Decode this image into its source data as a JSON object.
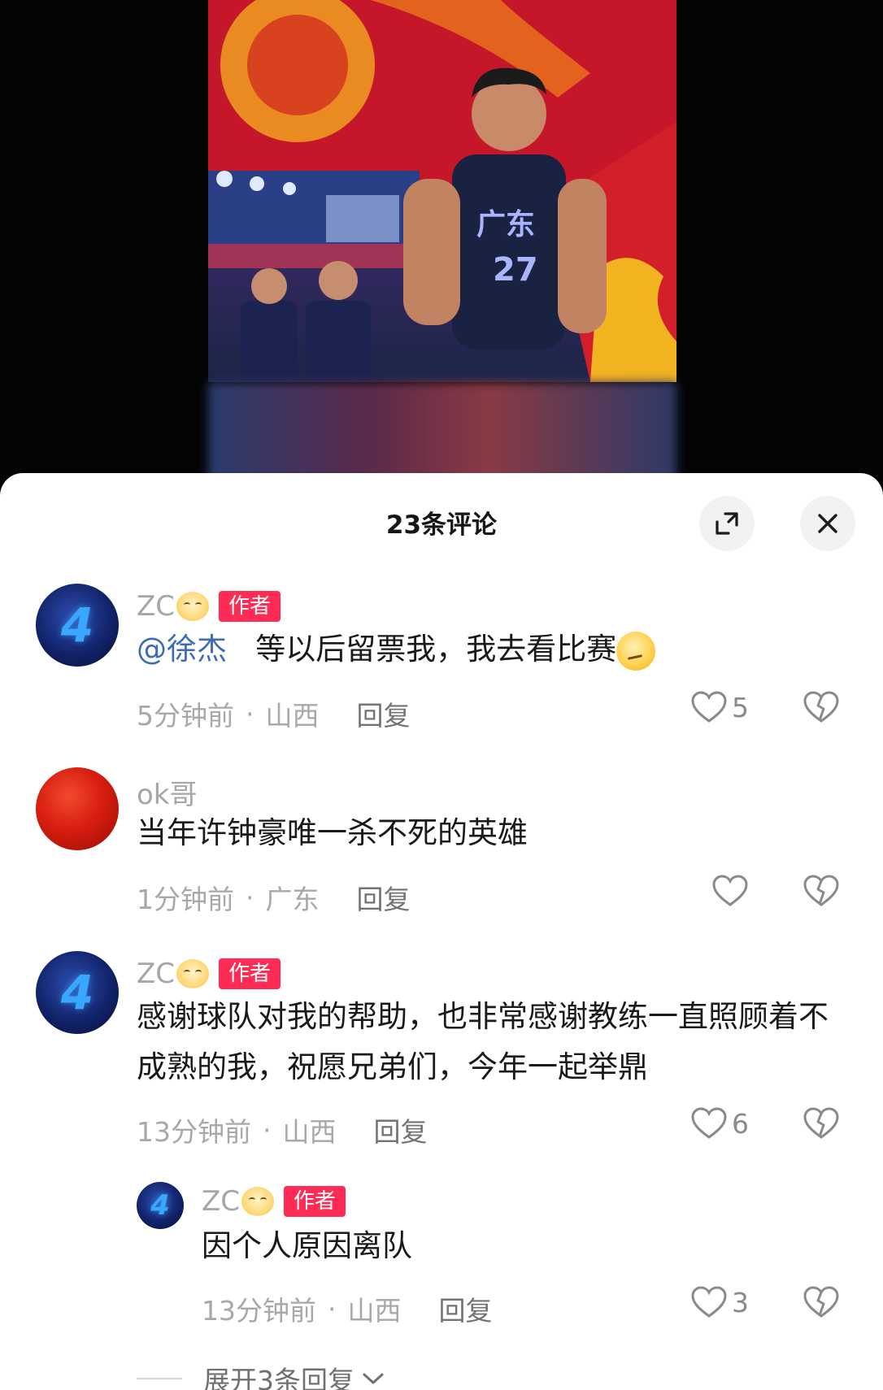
{
  "sheet": {
    "title": "23条评论"
  },
  "jersey": {
    "team": "广东",
    "number": "27"
  },
  "comments": [
    {
      "username": "ZC",
      "tag": "作者",
      "mention": "@徐杰",
      "text": "等以后留票我，我去看比赛",
      "time": "5分钟前",
      "location": "山西",
      "reply_label": "回复",
      "likes": "5",
      "avatar_text": "4"
    },
    {
      "username": "ok哥",
      "text": "当年许钟豪唯一杀不死的英雄",
      "time": "1分钟前",
      "location": "广东",
      "reply_label": "回复",
      "likes": ""
    },
    {
      "username": "ZC",
      "tag": "作者",
      "text": "感谢球队对我的帮助，也非常感谢教练一直照顾着不成熟的我，祝愿兄弟们，今年一起举鼎",
      "time": "13分钟前",
      "location": "山西",
      "reply_label": "回复",
      "likes": "6",
      "avatar_text": "4"
    },
    {
      "username": "ZC",
      "tag": "作者",
      "text": "因个人原因离队",
      "time": "13分钟前",
      "location": "山西",
      "reply_label": "回复",
      "likes": "3",
      "avatar_text": "4"
    }
  ],
  "expand_replies": "展开3条回复",
  "separator": "·",
  "icons": [
    "expand-icon",
    "close-icon",
    "heart-icon",
    "dislike-heart-icon",
    "chevron-down-icon"
  ]
}
